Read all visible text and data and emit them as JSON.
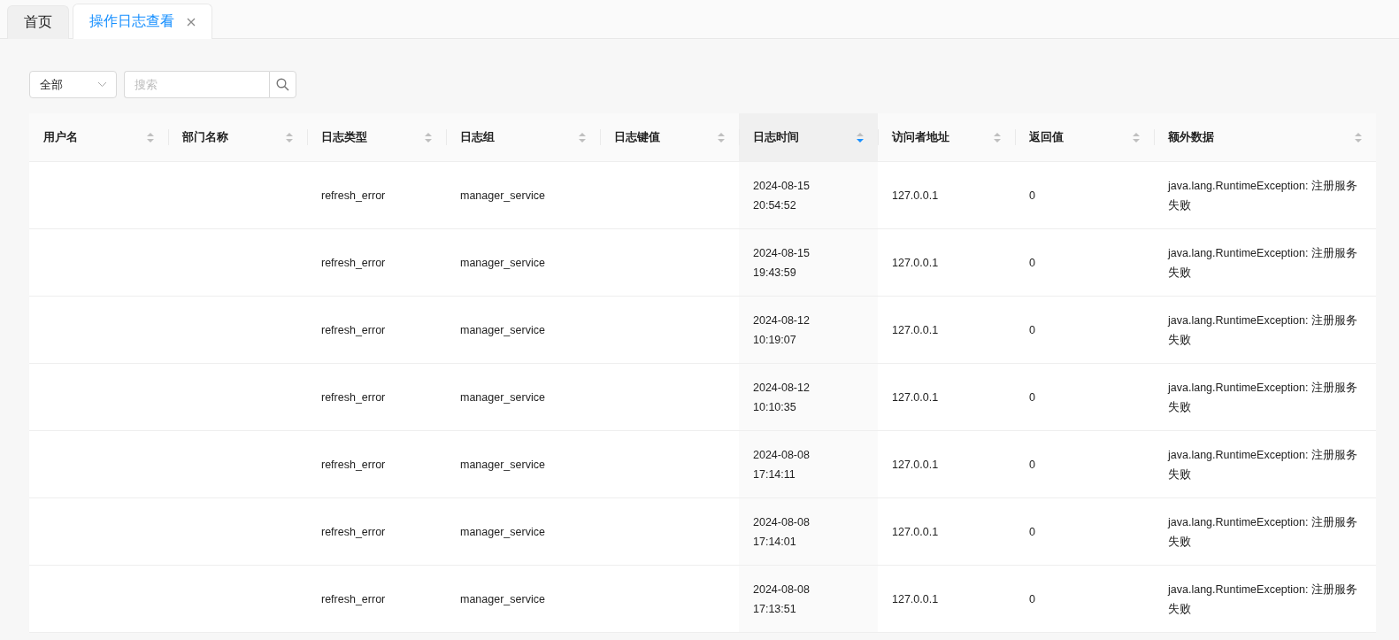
{
  "tabs": [
    {
      "label": "首页",
      "selected": false,
      "closable": false
    },
    {
      "label": "操作日志查看",
      "selected": true,
      "closable": true
    }
  ],
  "filter": {
    "value": "全部"
  },
  "search": {
    "placeholder": "搜索"
  },
  "table": {
    "columns": [
      {
        "label": "用户名",
        "sorted": false
      },
      {
        "label": "部门名称",
        "sorted": false
      },
      {
        "label": "日志类型",
        "sorted": false
      },
      {
        "label": "日志组",
        "sorted": false
      },
      {
        "label": "日志键值",
        "sorted": false
      },
      {
        "label": "日志时间",
        "sorted": true
      },
      {
        "label": "访问者地址",
        "sorted": false
      },
      {
        "label": "返回值",
        "sorted": false
      },
      {
        "label": "额外数据",
        "sorted": false
      }
    ],
    "rows": [
      {
        "log_type": "refresh_error",
        "log_group": "manager_service",
        "log_time": "2024-08-15 20:54:52",
        "address": "127.0.0.1",
        "return_value": "0",
        "extra": "java.lang.RuntimeException: 注册服务失败"
      },
      {
        "log_type": "refresh_error",
        "log_group": "manager_service",
        "log_time": "2024-08-15 19:43:59",
        "address": "127.0.0.1",
        "return_value": "0",
        "extra": "java.lang.RuntimeException: 注册服务失败"
      },
      {
        "log_type": "refresh_error",
        "log_group": "manager_service",
        "log_time": "2024-08-12 10:19:07",
        "address": "127.0.0.1",
        "return_value": "0",
        "extra": "java.lang.RuntimeException: 注册服务失败"
      },
      {
        "log_type": "refresh_error",
        "log_group": "manager_service",
        "log_time": "2024-08-12 10:10:35",
        "address": "127.0.0.1",
        "return_value": "0",
        "extra": "java.lang.RuntimeException: 注册服务失败"
      },
      {
        "log_type": "refresh_error",
        "log_group": "manager_service",
        "log_time": "2024-08-08 17:14:11",
        "address": "127.0.0.1",
        "return_value": "0",
        "extra": "java.lang.RuntimeException: 注册服务失败"
      },
      {
        "log_type": "refresh_error",
        "log_group": "manager_service",
        "log_time": "2024-08-08 17:14:01",
        "address": "127.0.0.1",
        "return_value": "0",
        "extra": "java.lang.RuntimeException: 注册服务失败"
      },
      {
        "log_type": "refresh_error",
        "log_group": "manager_service",
        "log_time": "2024-08-08 17:13:51",
        "address": "127.0.0.1",
        "return_value": "0",
        "extra": "java.lang.RuntimeException: 注册服务失败"
      }
    ]
  }
}
